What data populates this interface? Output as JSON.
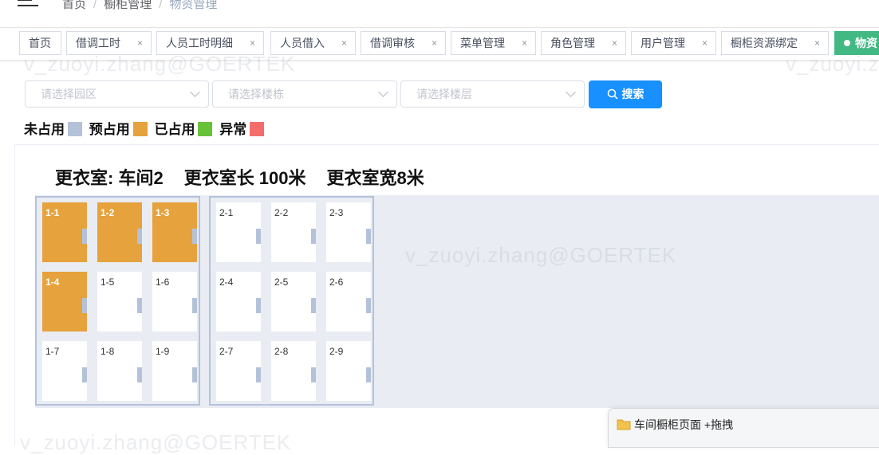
{
  "header": {
    "breadcrumb": [
      "首页",
      "橱柜管理",
      "物资管理"
    ]
  },
  "tabs": [
    {
      "label": "首页",
      "closable": false
    },
    {
      "label": "借调工时",
      "closable": true
    },
    {
      "label": "人员工时明细",
      "closable": true
    },
    {
      "label": "人员借入",
      "closable": true
    },
    {
      "label": "借调审核",
      "closable": true
    },
    {
      "label": "菜单管理",
      "closable": true
    },
    {
      "label": "角色管理",
      "closable": true
    },
    {
      "label": "用户管理",
      "closable": true
    },
    {
      "label": "橱柜资源绑定",
      "closable": true
    },
    {
      "label": "物资",
      "closable": false,
      "active": true
    }
  ],
  "tab_close_symbol": "×",
  "watermark": "v_zuoyi.zhang@GOERTEK",
  "filters": {
    "park_placeholder": "请选择园区",
    "building_placeholder": "请选择楼栋",
    "floor_placeholder": "请选择楼层",
    "search_label": "搜索"
  },
  "legend": [
    {
      "label": "未占用",
      "color": "#b4c2d9"
    },
    {
      "label": "预占用",
      "color": "#e6a23c"
    },
    {
      "label": "已占用",
      "color": "#67c23a"
    },
    {
      "label": "异常",
      "color": "#f56c6c"
    }
  ],
  "room": {
    "name": "更衣室: 车间2",
    "length": "更衣室长 100米",
    "width": "更衣室宽8米"
  },
  "locker_groups": [
    {
      "lockers": [
        {
          "label": "1-1",
          "status": "预占用"
        },
        {
          "label": "1-2",
          "status": "预占用"
        },
        {
          "label": "1-3",
          "status": "预占用"
        },
        {
          "label": "1-4",
          "status": "预占用"
        },
        {
          "label": "1-5",
          "status": "未占用"
        },
        {
          "label": "1-6",
          "status": "未占用"
        },
        {
          "label": "1-7",
          "status": "未占用"
        },
        {
          "label": "1-8",
          "status": "未占用"
        },
        {
          "label": "1-9",
          "status": "未占用"
        }
      ]
    },
    {
      "lockers": [
        {
          "label": "2-1",
          "status": "未占用"
        },
        {
          "label": "2-2",
          "status": "未占用"
        },
        {
          "label": "2-3",
          "status": "未占用"
        },
        {
          "label": "2-4",
          "status": "未占用"
        },
        {
          "label": "2-5",
          "status": "未占用"
        },
        {
          "label": "2-6",
          "status": "未占用"
        },
        {
          "label": "2-7",
          "status": "未占用"
        },
        {
          "label": "2-8",
          "status": "未占用"
        },
        {
          "label": "2-9",
          "status": "未占用"
        }
      ]
    }
  ],
  "popup": {
    "icon": "folder-icon",
    "label": "车间橱柜页面 +拖拽"
  }
}
